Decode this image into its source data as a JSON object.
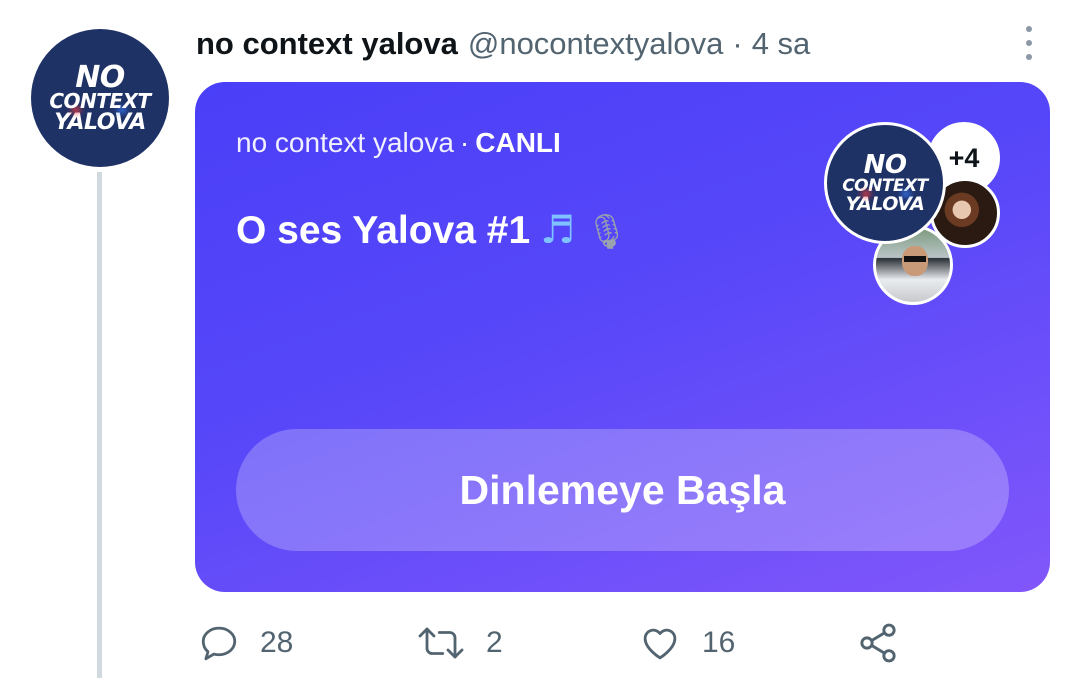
{
  "author": {
    "avatar_logo_lines": [
      "NO",
      "CONTEXT",
      "YALOVA"
    ],
    "display_name": "no context yalova",
    "handle": "@nocontextyalova",
    "separator": "·",
    "time": "4 sa"
  },
  "space_card": {
    "host": "no context yalova",
    "separator": "·",
    "status": "CANLI",
    "title": "O ses Yalova #1",
    "title_emojis": [
      "music-notes",
      "microphone"
    ],
    "listener_extra": "+4",
    "button_label": "Dinlemeye Başla",
    "gradient_colors": [
      "#4a3ff8",
      "#8157fa"
    ]
  },
  "actions": {
    "reply_count": "28",
    "retweet_count": "2",
    "like_count": "16"
  },
  "icons": [
    "more-icon",
    "reply-icon",
    "retweet-icon",
    "like-icon",
    "share-icon"
  ]
}
